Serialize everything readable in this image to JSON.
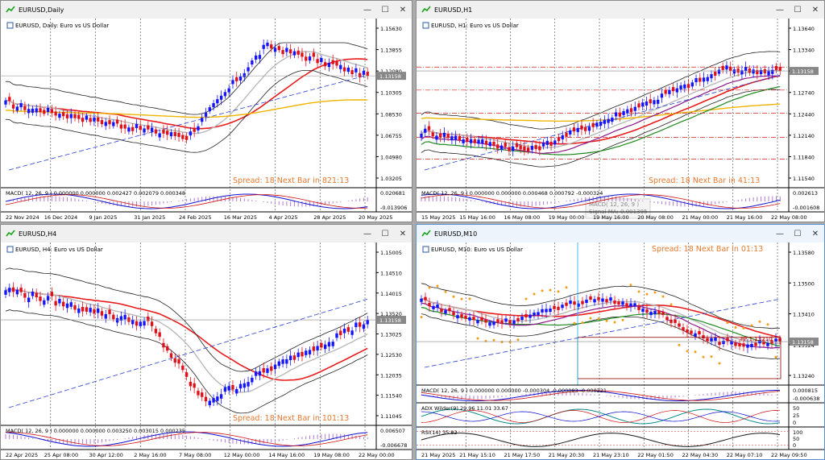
{
  "windows": [
    {
      "title": "EURUSD,Daily",
      "symbol_desc": "EURUSD, Daily: Euro vs US Dollar",
      "spread": "Spread: 18  Next Bar in 821:13",
      "macd": "MACD( 12, 26, 9 ) 0.000000 0.000000 0.002427 0.002079 0.000348",
      "prices": [
        "1.15630",
        "1.13855",
        "1.12080",
        "1.10305",
        "1.08530",
        "1.06755",
        "1.04980",
        "1.03205"
      ],
      "current_price": "1.13158",
      "macd_scale": [
        "0.020681",
        "-0.013906"
      ],
      "times": [
        "22 Nov 2024",
        "16 Dec 2024",
        "9 Jan 2025",
        "31 Jan 2025",
        "24 Feb 2025",
        "16 Mar 2025",
        "4 Apr 2025",
        "28 Apr 2025",
        "20 May 2025"
      ]
    },
    {
      "title": "EURUSD,H1",
      "symbol_desc": "EURUSD, H1: Euro vs US Dollar",
      "spread": "Spread: 18  Next Bar in 41:13",
      "macd": "MACD( 12, 26, 9 ) 0.000000 0.000000 0.000468 0.000792 -0.000324",
      "prices": [
        "1.13640",
        "1.13340",
        "1.13040",
        "1.12740",
        "1.12440",
        "1.12140",
        "1.11840",
        "1.11540"
      ],
      "current_price": "1.13158",
      "macd_scale": [
        "0.002613",
        "-0.001608"
      ],
      "times": [
        "15 May 2025",
        "15 May 16:00",
        "16 May 08:00",
        "19 May 00:00",
        "19 May 16:00",
        "20 May 08:00",
        "21 May 00:00",
        "21 May 16:00",
        "22 May 08:00"
      ],
      "tooltip": [
        "MACD( 12, 26, 9 )",
        "Signal MA: 0.001395"
      ]
    },
    {
      "title": "EURUSD,H4",
      "symbol_desc": "EURUSD, H4: Euro vs US Dollar",
      "spread": "Spread: 18  Next Bar in 101:13",
      "macd": "MACD( 12, 26, 9 ) 0.000000 0.000000 0.003250 0.003015 0.000235",
      "prices": [
        "1.15005",
        "1.14510",
        "1.14015",
        "1.13520",
        "1.13025",
        "1.12530",
        "1.12035",
        "1.11540",
        "1.11045"
      ],
      "current_price": "1.13158",
      "macd_scale": [
        "0.006507",
        "-0.006678"
      ],
      "times": [
        "22 Apr 2025",
        "25 Apr 08:00",
        "30 Apr 12:00",
        "2 May 16:00",
        "7 May 08:00",
        "12 May 00:00",
        "14 May 16:00",
        "19 May 08:00",
        "22 May 00:00"
      ]
    },
    {
      "title": "EURUSD,M10",
      "symbol_desc": "EURUSD, M10: Euro vs US Dollar",
      "spread": "Spread: 18  Next Bar in 01:13",
      "macd": "MACD( 12, 26, 9 ) 0.000000 0.000000 -0.000304 -0.000083 -0.000221",
      "adx": "ADX Wilder(9) 29.96 11.01 33.67",
      "rsi": "RSI(14) 35.82",
      "pp": "PP 1.13210",
      "prices": [
        "1.13580",
        "1.13500",
        "1.13410",
        "1.13324",
        "1.13240"
      ],
      "current_price": "1.13158",
      "macd_scale": [
        "0.000815",
        "-0.000638"
      ],
      "adx_scale": [
        "50",
        "25",
        "0"
      ],
      "rsi_scale": [
        "100",
        "50",
        "0"
      ],
      "times": [
        "21 May 2025",
        "21 May 15:10",
        "21 May 17:50",
        "21 May 20:30",
        "21 May 23:10",
        "22 May 01:50",
        "22 May 04:30",
        "22 May 07:10",
        "22 May 09:50"
      ]
    }
  ],
  "colors": {
    "bull": "#1414ff",
    "bear": "#e0101a",
    "bg": "#ffffff"
  }
}
